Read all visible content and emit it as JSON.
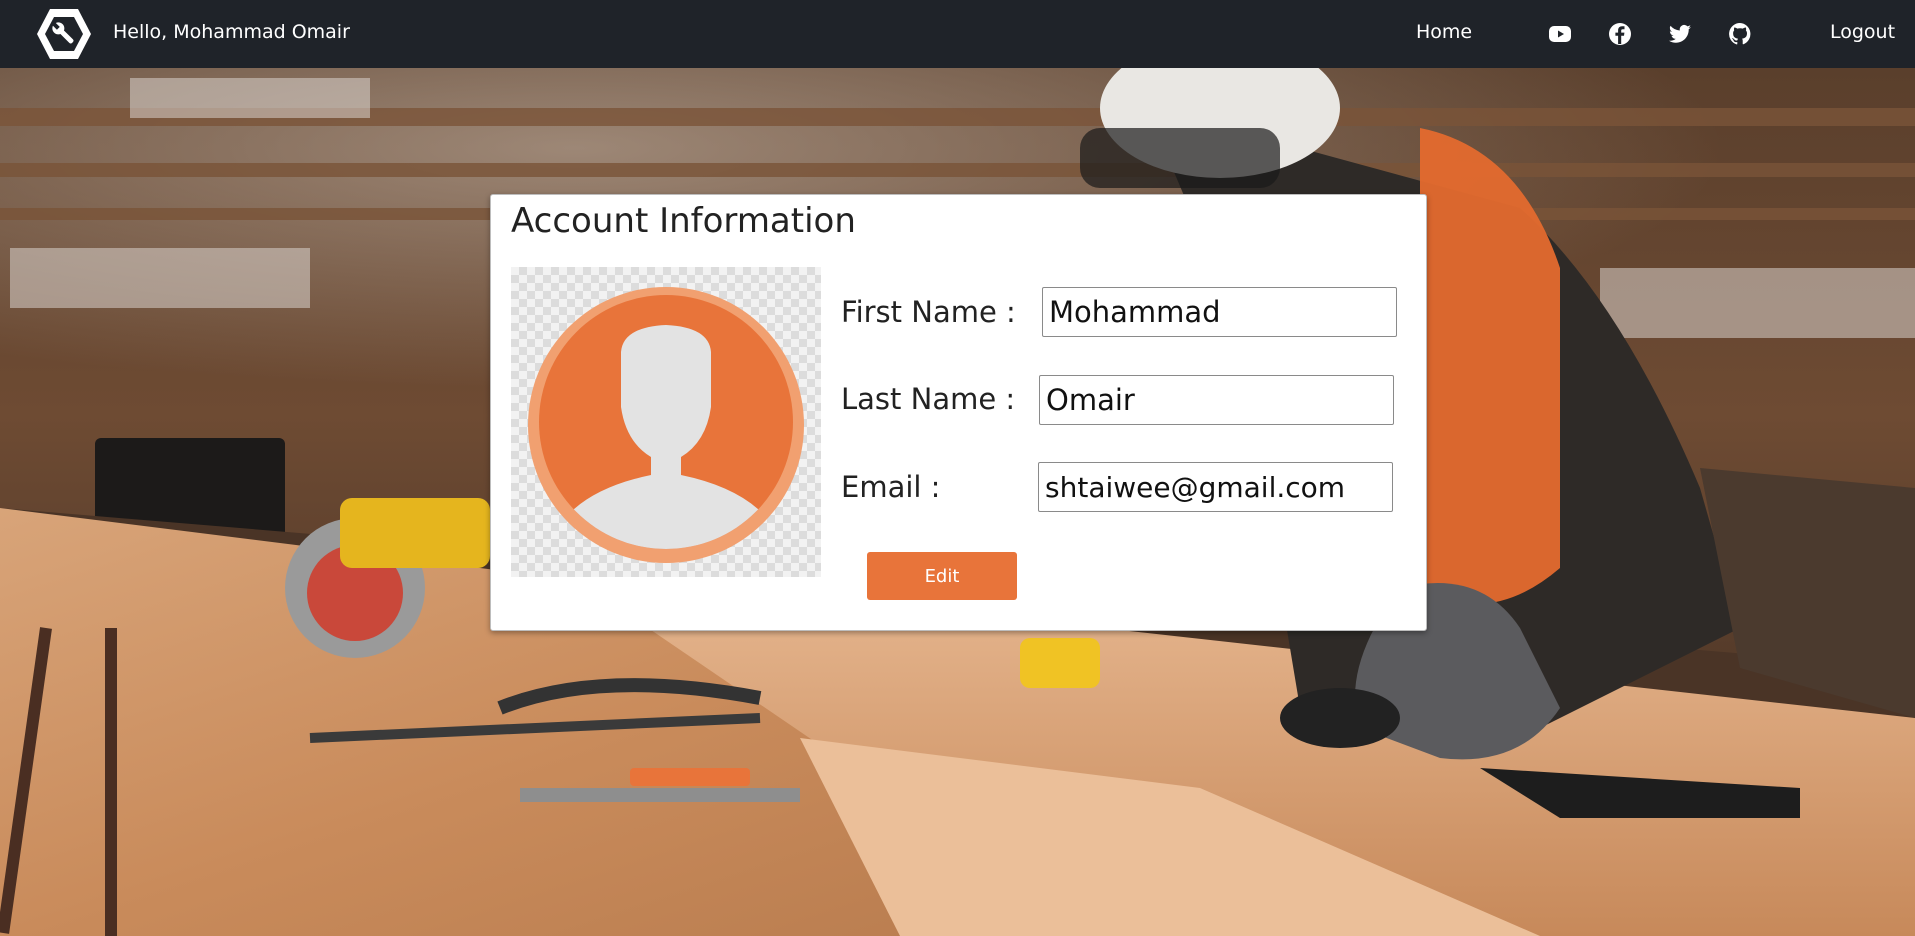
{
  "navbar": {
    "greeting": "Hello, Mohammad Omair",
    "home_label": "Home",
    "logout_label": "Logout",
    "social_icons": [
      "youtube-icon",
      "facebook-icon",
      "twitter-icon",
      "github-icon"
    ]
  },
  "account": {
    "title": "Account Information",
    "first_name_label": "First Name :",
    "first_name_value": "Mohammad",
    "last_name_label": "Last Name :",
    "last_name_value": "Omair",
    "email_label": "Email :",
    "email_value": "shtaiwee@gmail.com",
    "edit_label": "Edit"
  },
  "colors": {
    "navbar_bg": "#1f2329",
    "accent": "#e8743a",
    "avatar_orange": "#e8743a",
    "card_bg": "#ffffff"
  }
}
